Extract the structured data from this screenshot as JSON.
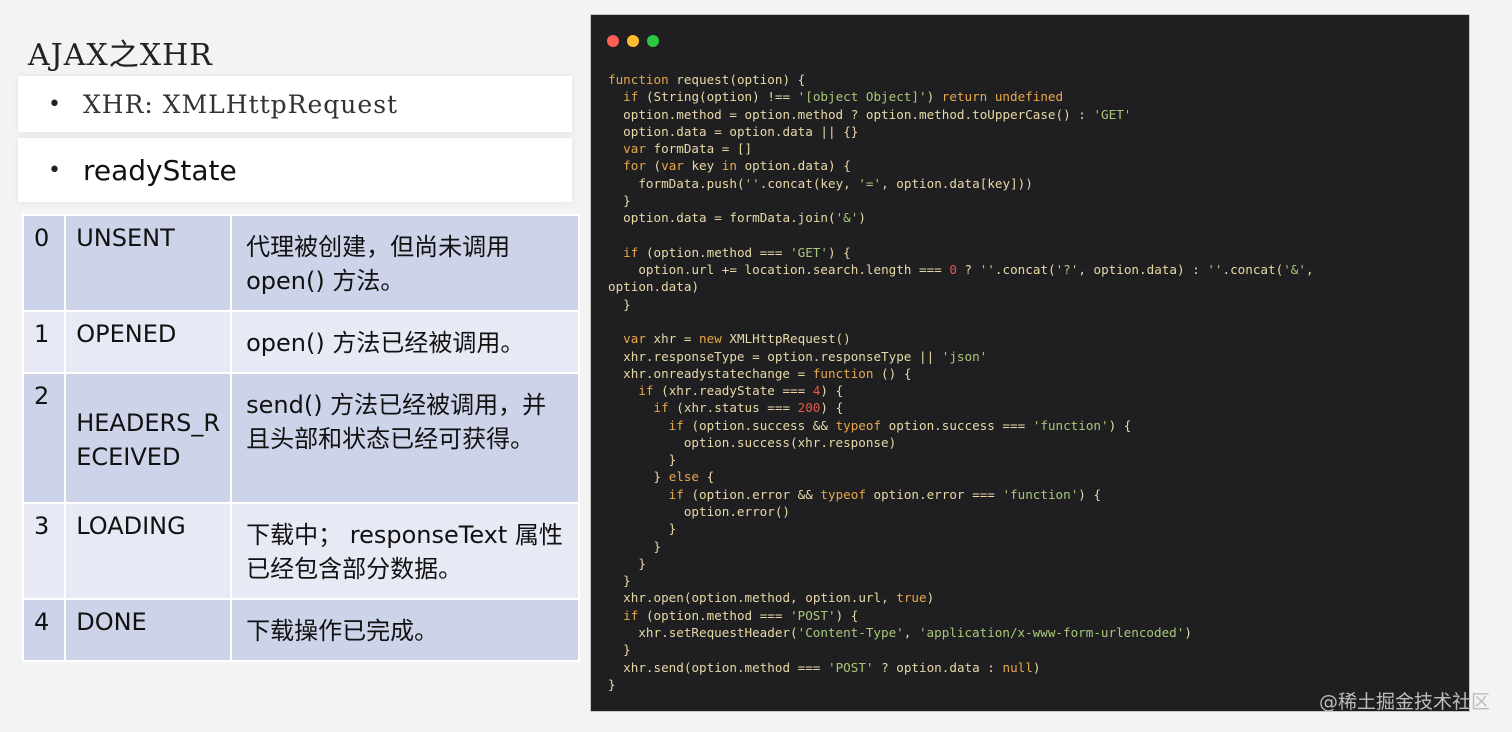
{
  "slide": {
    "title": "AJAX之XHR",
    "bullet_xhr": "XHR: XMLHttpRequest",
    "bullet_readystate": "readyState",
    "bullet_mark": "•"
  },
  "states": [
    {
      "code": "0",
      "name": "UNSENT",
      "desc": "代理被创建，但尚未调用 open() 方法。"
    },
    {
      "code": "1",
      "name": "OPENED",
      "desc": "open() 方法已经被调用。"
    },
    {
      "code": "2",
      "name": "HEADERS_RECEIVED",
      "desc": "send() 方法已经被调用，并且头部和状态已经可获得。"
    },
    {
      "code": "3",
      "name": "LOADING",
      "desc": "下载中；  responseText 属性已经包含部分数据。"
    },
    {
      "code": "4",
      "name": "DONE",
      "desc": "下载操作已完成。"
    }
  ],
  "code_lines": [
    "function request(option) {",
    "  if (String(option) !== '[object Object]') return undefined",
    "  option.method = option.method ? option.method.toUpperCase() : 'GET'",
    "  option.data = option.data || {}",
    "  var formData = []",
    "  for (var key in option.data) {",
    "    formData.push(''.concat(key, '=', option.data[key]))",
    "  }",
    "  option.data = formData.join('&')",
    "",
    "  if (option.method === 'GET') {",
    "    option.url += location.search.length === 0 ? ''.concat('?', option.data) : ''.concat('&',",
    "option.data)",
    "  }",
    "",
    "  var xhr = new XMLHttpRequest()",
    "  xhr.responseType = option.responseType || 'json'",
    "  xhr.onreadystatechange = function () {",
    "    if (xhr.readyState === 4) {",
    "      if (xhr.status === 200) {",
    "        if (option.success && typeof option.success === 'function') {",
    "          option.success(xhr.response)",
    "        }",
    "      } else {",
    "        if (option.error && typeof option.error === 'function') {",
    "          option.error()",
    "        }",
    "      }",
    "    }",
    "  }",
    "  xhr.open(option.method, option.url, true)",
    "  if (option.method === 'POST') {",
    "    xhr.setRequestHeader('Content-Type', 'application/x-www-form-urlencoded')",
    "  }",
    "  xhr.send(option.method === 'POST' ? option.data : null)",
    "}"
  ],
  "watermark": "@稀土掘金技术社区",
  "colors": {
    "code_background": "#1f1f21",
    "row_dark": "#cdd3e8",
    "row_light": "#e7eaf4",
    "keyword": "#e8a848",
    "string": "#a8c878",
    "number": "#e35a4a",
    "plain": "#e8d9a6"
  }
}
